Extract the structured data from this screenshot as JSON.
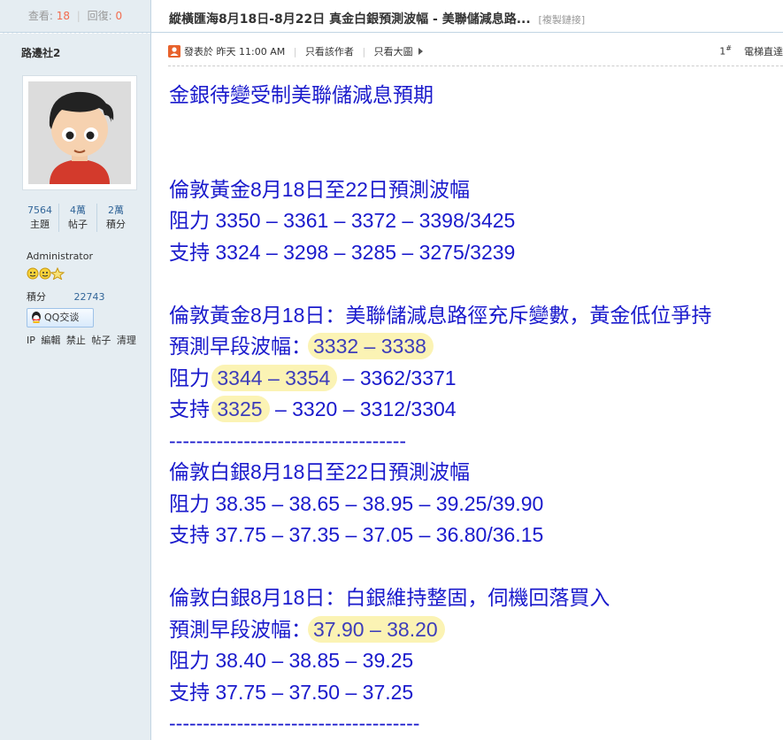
{
  "stats": {
    "views_label": "查看:",
    "views": "18",
    "replies_label": "回復:",
    "replies": "0"
  },
  "thread": {
    "title": "縱橫匯海8月18日-8月22日 真金白銀預測波幅 - 美聯儲減息路...",
    "copy_link": "[複製鏈接]"
  },
  "author": {
    "name": "路邊社2",
    "stats": [
      {
        "num": "7564",
        "label": "主題"
      },
      {
        "num": "4萬",
        "label": "帖子"
      },
      {
        "num": "2萬",
        "label": "積分"
      }
    ],
    "group": "Administrator",
    "credit_label": "積分",
    "credit_value": "22743",
    "qq_label": "QQ交谈",
    "admin_links": [
      "IP",
      "編輯",
      "禁止",
      "帖子",
      "清理"
    ]
  },
  "post_meta": {
    "posted_prefix": "發表於",
    "posted_time": "昨天 11:00 AM",
    "only_author": "只看該作者",
    "only_big_image": "只看大圖",
    "floor": "1",
    "floor_sup": "#",
    "elevator": "電梯直達"
  },
  "content": {
    "headline": "金銀待變受制美聯儲減息預期",
    "gold_week_title": "倫敦黃金8月18日至22日預測波幅",
    "gold_week_resistance": "阻力 3350 – 3361 – 3372 – 3398/3425",
    "gold_week_support": "支持 3324 – 3298 – 3285 – 3275/3239",
    "gold_day_title": "倫敦黃金8月18日：美聯儲減息路徑充斥變數，黃金低位爭持",
    "gold_day_range_label": "預測早段波幅：",
    "gold_day_range": "3332 – 3338",
    "gold_day_resistance_label": "阻力",
    "gold_day_resistance_hl": "3344 – 3354",
    "gold_day_resistance_rest": " – 3362/3371",
    "gold_day_support_label": "支持",
    "gold_day_support_hl": "3325",
    "gold_day_support_rest": " – 3320 – 3312/3304",
    "divider1": "-----------------------------------",
    "silver_week_title": "倫敦白銀8月18日至22日預測波幅",
    "silver_week_resistance": "阻力 38.35 – 38.65 – 38.95 – 39.25/39.90",
    "silver_week_support": "支持 37.75 – 37.35 – 37.05 – 36.80/36.15",
    "silver_day_title": "倫敦白銀8月18日：白銀維持整固，伺機回落買入",
    "silver_day_range_label": "預測早段波幅：",
    "silver_day_range": "37.90 – 38.20",
    "silver_day_resistance": "阻力 38.40 – 38.85 – 39.25",
    "silver_day_support": "支持 37.75 – 37.50 – 37.25",
    "divider2": "-------------------------------------"
  }
}
